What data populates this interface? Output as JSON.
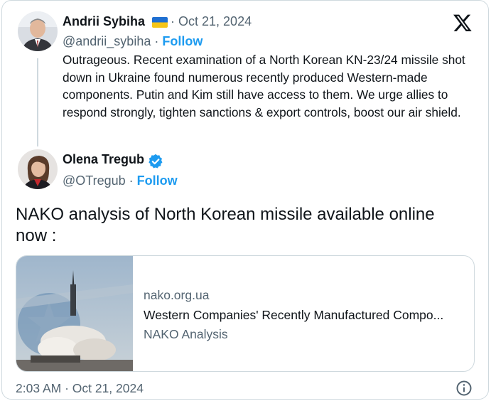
{
  "quoted": {
    "author_name": "Andrii Sybiha",
    "flag_icon": "ukraine-flag-icon",
    "separator": "·",
    "date": "Oct 21, 2024",
    "handle": "@andrii_sybiha",
    "follow_label": "Follow",
    "text": "Outrageous. Recent examination of a North Korean KN-23/24 missile shot down in Ukraine found numerous recently produced Western-made components. Putin and Kim still have access to them. We urge allies to respond strongly, tighten sanctions & export controls, boost our air shield."
  },
  "reply": {
    "author_name": "Olena Tregub",
    "verified_icon": "verified-badge-icon",
    "handle": "@OTregub",
    "separator": "·",
    "follow_label": "Follow",
    "text": "NAKO analysis of North Korean missile available online now :"
  },
  "link_card": {
    "domain": "nako.org.ua",
    "title": "Western Companies' Recently Manufactured Compo...",
    "source": "NAKO Analysis"
  },
  "footer": {
    "timestamp": "2:03 AM · Oct 21, 2024",
    "info_icon": "info-icon"
  },
  "brand": {
    "logo_icon": "x-logo-icon",
    "accent_color": "#1d9bf0",
    "muted_color": "#536471",
    "border_color": "#cfd9de"
  }
}
